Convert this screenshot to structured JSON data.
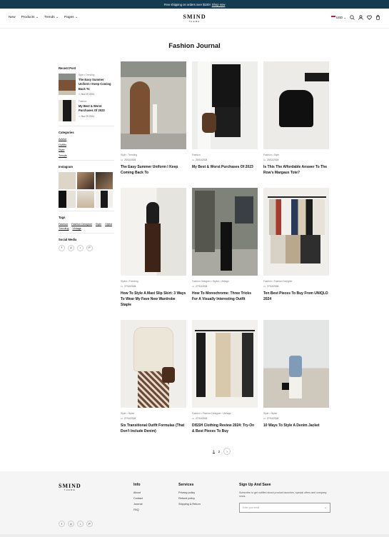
{
  "announcement": {
    "text": "Free shipping on orders over $100!",
    "link": "Shop now"
  },
  "nav": {
    "items": [
      "New",
      "Products",
      "Trends",
      "Pages"
    ]
  },
  "brand": {
    "name": "SMIND",
    "tagline": "THEME"
  },
  "header": {
    "currency": "USD"
  },
  "page": {
    "title": "Fashion Journal"
  },
  "sidebar": {
    "recent_title": "Recent Post",
    "recent": [
      {
        "meta": "Style • Trending",
        "title": "The Easy Summer Uniform I Keep Coming Back To",
        "date": "Nov 29 2024"
      },
      {
        "meta": "Fashion",
        "title": "My Best & Worst Purchases Of 2023",
        "date": "Nov 29 2024"
      }
    ],
    "categories_title": "Categories",
    "categories": [
      "Advice",
      "Outfits",
      "Style",
      "Trends"
    ],
    "instagram_title": "Instagram",
    "tags_title": "Tags",
    "tags": [
      "Fashion",
      "Fashion Designer",
      "Style",
      "Stylist",
      "Trending",
      "Vintage"
    ],
    "social_title": "Social Media"
  },
  "posts": [
    {
      "category": "Style • Trending",
      "date": "20/11/2024",
      "title": "The Easy Summer Uniform I Keep Coming Back To"
    },
    {
      "category": "Fashion",
      "date": "20/11/2024",
      "title": "My Best & Worst Purchases Of 2023"
    },
    {
      "category": "Fashion • Style",
      "date": "20/11/2024",
      "title": "Is This The Affordable Answer To The Row's Margaux Tote?"
    },
    {
      "category": "Stylist • Trending",
      "date": "27/11/2024",
      "title": "How To Style A Maxi Slip Skirt: 3 Ways To Wear My Fave New Wardrobe Staple"
    },
    {
      "category": "Fashion Designer • Stylist • Vintage",
      "date": "27/11/2024",
      "title": "How To Monochrome: Three Tricks For A Visually Interesting Outfit"
    },
    {
      "category": "Fashion • Fashion Designer",
      "date": "27/11/2024",
      "title": "Ten Best Pieces To Buy From UNIQLO 2024"
    },
    {
      "category": "Style • Stylist",
      "date": "27/11/2024",
      "title": "Six Transitional Outfit Formulas (That Don't Include Denim)"
    },
    {
      "category": "Fashion • Fashion Designer • Vintage",
      "date": "27/11/2024",
      "title": "DISSH Clothing Review 2024: Try-On & Best Pieces To Buy"
    },
    {
      "category": "Style • Stylist",
      "date": "27/11/2024",
      "title": "10 Ways To Style A Denim Jacket"
    }
  ],
  "pagination": {
    "pages": [
      "1",
      "2"
    ]
  },
  "footer": {
    "info_title": "Info",
    "info_links": [
      "About",
      "Contact",
      "Journal",
      "FAQ"
    ],
    "services_title": "Services",
    "services_links": [
      "Privacy policy",
      "Refund policy",
      "Shipping & Return"
    ],
    "signup_title": "Sign Up And Save",
    "signup_text": "Subscribe to get notified about product launches, special offers and company news.",
    "email_placeholder": "Enter your email"
  }
}
